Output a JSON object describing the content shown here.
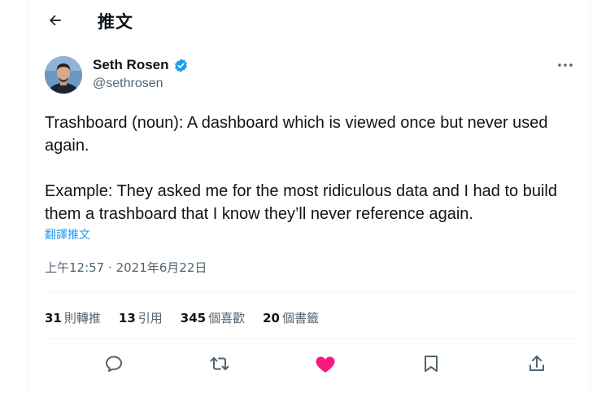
{
  "header": {
    "back_icon": "arrow-left-icon",
    "title": "推文"
  },
  "author": {
    "display_name": "Seth Rosen",
    "handle": "@sethrosen",
    "verified": true,
    "verified_color": "#1d9bf0"
  },
  "tweet": {
    "paragraphs": [
      "Trashboard (noun): A dashboard which is viewed once but never used again.",
      "Example: They asked me for the most ridiculous data and I had to build them a trashboard that I know they’ll never reference again."
    ],
    "translate_label": "翻譯推文",
    "time": "上午12:57",
    "separator": "·",
    "date": "2021年6月22日"
  },
  "stats": [
    {
      "count": "31",
      "label": "則轉推"
    },
    {
      "count": "13",
      "label": "引用"
    },
    {
      "count": "345",
      "label": "個喜歡"
    },
    {
      "count": "20",
      "label": "個書籤"
    }
  ],
  "actions": [
    {
      "icon": "reply-icon"
    },
    {
      "icon": "retweet-icon"
    },
    {
      "icon": "like-icon",
      "active": true,
      "color": "#f91880"
    },
    {
      "icon": "bookmark-icon"
    },
    {
      "icon": "share-icon"
    }
  ],
  "colors": {
    "accent": "#1d9bf0",
    "like": "#f91880",
    "secondary_text": "#536471",
    "primary_text": "#0f1419"
  }
}
